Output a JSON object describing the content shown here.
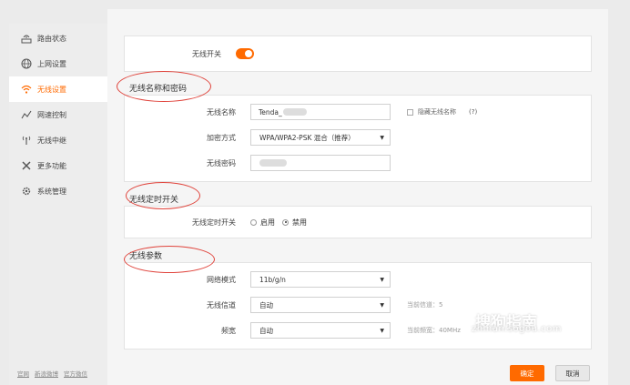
{
  "sidebar": {
    "items": [
      {
        "label": "路由状态",
        "icon": "router-icon"
      },
      {
        "label": "上网设置",
        "icon": "globe-icon"
      },
      {
        "label": "无线设置",
        "icon": "wifi-icon"
      },
      {
        "label": "网速控制",
        "icon": "speed-chart-icon"
      },
      {
        "label": "无线中继",
        "icon": "repeater-icon"
      },
      {
        "label": "更多功能",
        "icon": "tools-icon"
      },
      {
        "label": "系统管理",
        "icon": "gear-icon"
      }
    ],
    "active_index": 2,
    "footer_links": [
      "官网",
      "新浪微博",
      "官方微信"
    ]
  },
  "wireless_switch": {
    "label": "无线开关",
    "enabled": true
  },
  "section_name_pwd": {
    "title": "无线名称和密码",
    "ssid_label": "无线名称",
    "ssid_value": "Tenda_",
    "hide_ssid_label": "隐藏无线名称",
    "help": "(?)",
    "encryption_label": "加密方式",
    "encryption_value": "WPA/WPA2-PSK 混合（推荐）",
    "password_label": "无线密码"
  },
  "section_timer": {
    "title": "无线定时开关",
    "label": "无线定时开关",
    "opt_on": "启用",
    "opt_off": "禁用",
    "selected": "禁用"
  },
  "section_params": {
    "title": "无线参数",
    "mode_label": "网络模式",
    "mode_value": "11b/g/n",
    "channel_label": "无线信道",
    "channel_value": "自动",
    "channel_hint": "当前信道：5",
    "bandwidth_label": "频宽",
    "bandwidth_value": "自动",
    "bandwidth_hint": "当前频宽：40MHz"
  },
  "buttons": {
    "ok": "确定",
    "cancel": "取消"
  },
  "watermark": {
    "main": "搜狗指南",
    "sub": "zhinan.sogou.com"
  },
  "colors": {
    "accent": "#ff6a00",
    "annotation": "#e0443c"
  }
}
